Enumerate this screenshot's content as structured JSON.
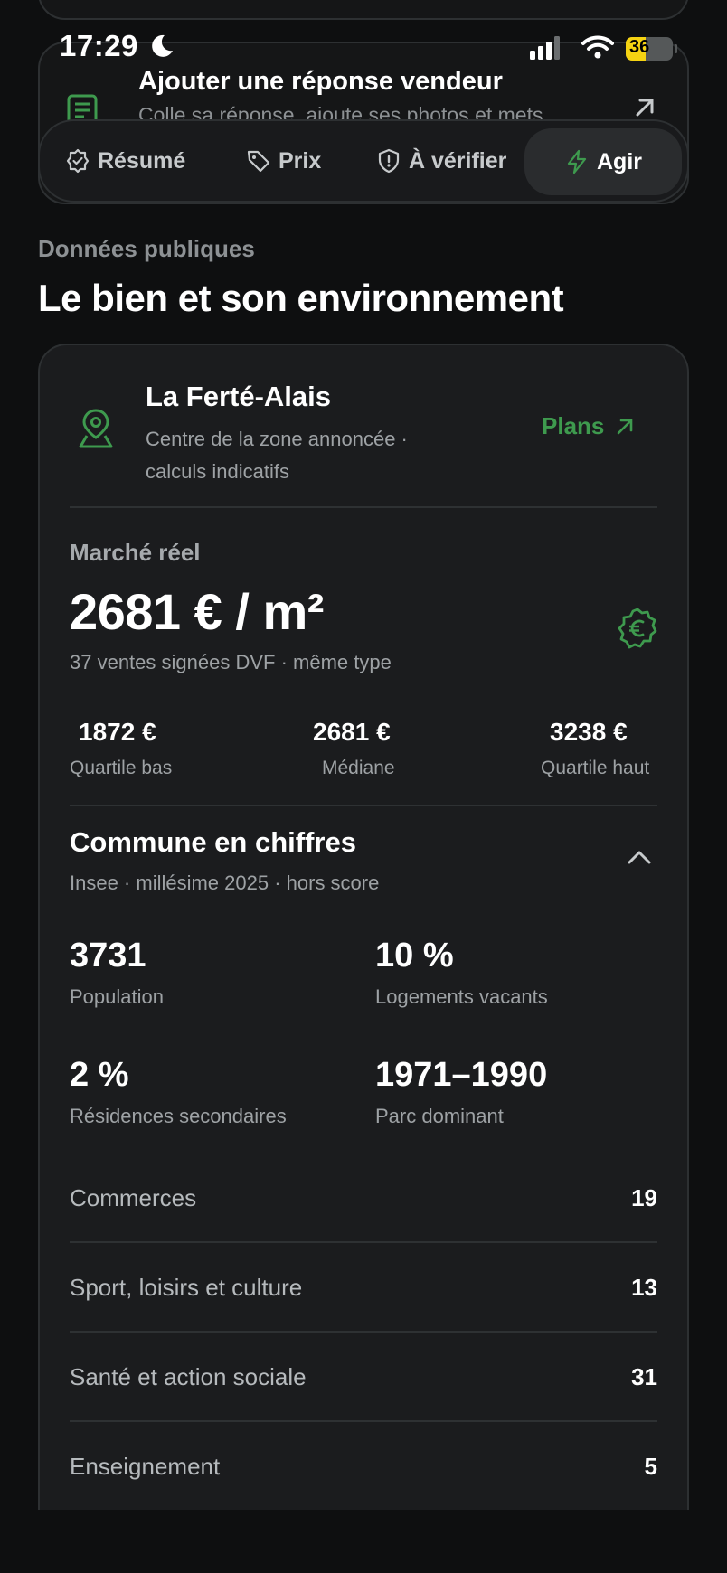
{
  "status_bar": {
    "time": "17:29",
    "battery": "36"
  },
  "seller_card": {
    "title": "Ajouter une réponse vendeur",
    "subtitle": "Colle sa réponse, ajoute ses photos et mets"
  },
  "tabs": [
    {
      "label": "Résumé",
      "icon": "shield-check-icon",
      "active": false
    },
    {
      "label": "Prix",
      "icon": "tag-icon",
      "active": false
    },
    {
      "label": "À vérifier",
      "icon": "shield-alert-icon",
      "active": false
    },
    {
      "label": "Agir",
      "icon": "bolt-icon",
      "active": true
    }
  ],
  "section": {
    "eyebrow": "Données publiques",
    "title": "Le bien et son environnement"
  },
  "location": {
    "name": "La Ferté-Alais",
    "description": "Centre de la zone annoncée · calculs indicatifs",
    "plans_label": "Plans"
  },
  "market": {
    "label": "Marché réel",
    "price": "2681 € / m²",
    "subtitle": "37 ventes signées DVF · même type",
    "quartiles": [
      {
        "value": "1872 €",
        "label": "Quartile bas"
      },
      {
        "value": "2681 €",
        "label": "Médiane"
      },
      {
        "value": "3238 €",
        "label": "Quartile haut"
      }
    ]
  },
  "commune": {
    "title": "Commune en chiffres",
    "subtitle": "Insee · millésime 2025 · hors score",
    "stats": [
      {
        "value": "3731",
        "label": "Population"
      },
      {
        "value": "10 %",
        "label": "Logements vacants"
      },
      {
        "value": "2 %",
        "label": "Résidences secondaires"
      },
      {
        "value": "1971–1990",
        "label": "Parc dominant"
      }
    ],
    "equipments": [
      {
        "label": "Commerces",
        "value": "19"
      },
      {
        "label": "Sport, loisirs et culture",
        "value": "13"
      },
      {
        "label": "Santé et action sociale",
        "value": "31"
      },
      {
        "label": "Enseignement",
        "value": "5"
      }
    ]
  },
  "colors": {
    "accent_green": "#3e9a4e",
    "background": "#0e0f10",
    "card": "#1b1c1e"
  }
}
